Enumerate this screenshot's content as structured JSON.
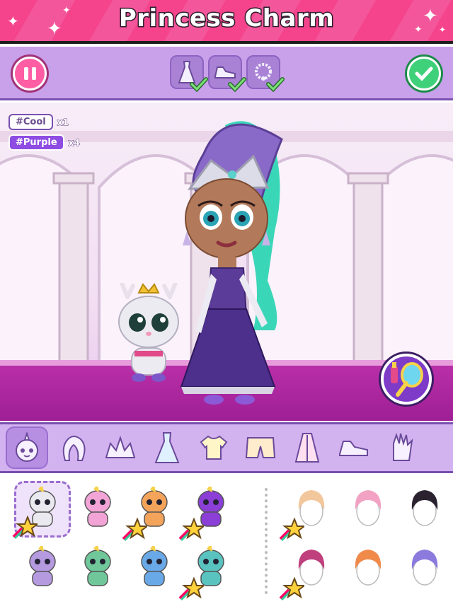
{
  "header": {
    "title": "Princess Charm"
  },
  "toolbar": {
    "pause_icon": "pause-icon",
    "done_icon": "check-icon",
    "progress_slots": [
      {
        "icon": "dress-icon",
        "complete": true
      },
      {
        "icon": "sneaker-icon",
        "complete": true
      },
      {
        "icon": "necklace-icon",
        "complete": true
      }
    ]
  },
  "scene": {
    "tags": [
      {
        "label": "#Cool",
        "count": "x1"
      },
      {
        "label": "#Purple",
        "count": "x4"
      }
    ],
    "mirror_icon": "makeup-mirror-icon"
  },
  "categories": [
    {
      "icon": "unicorn-pet-icon",
      "active": true
    },
    {
      "icon": "hair-icon",
      "active": false
    },
    {
      "icon": "tiara-icon",
      "active": false
    },
    {
      "icon": "dress-icon",
      "active": false
    },
    {
      "icon": "top-icon",
      "active": false
    },
    {
      "icon": "shorts-icon",
      "active": false
    },
    {
      "icon": "cape-icon",
      "active": false
    },
    {
      "icon": "sneaker-icon",
      "active": false
    },
    {
      "icon": "glove-icon",
      "active": false
    }
  ],
  "items": {
    "pets": [
      {
        "name": "deer-pet",
        "color": "#e9e9ef",
        "premium": true,
        "selected": true
      },
      {
        "name": "pink-pony",
        "color": "#f3a4d6",
        "premium": false
      },
      {
        "name": "orange-pony",
        "color": "#f4a45a",
        "premium": true
      },
      {
        "name": "purple-dragon",
        "color": "#8b3fd6",
        "premium": true
      },
      {
        "name": "lavender-pony",
        "color": "#b59ae0",
        "premium": false
      },
      {
        "name": "green-pony",
        "color": "#6fc79a",
        "premium": false
      },
      {
        "name": "blue-pony",
        "color": "#6aa9e8",
        "premium": false
      },
      {
        "name": "teal-dragon",
        "color": "#59c3c0",
        "premium": true
      }
    ],
    "hairstyles": [
      {
        "name": "blonde-ponytail",
        "color": "#f2c79b",
        "premium": true
      },
      {
        "name": "pink-bob",
        "color": "#f2a3c4",
        "premium": false
      },
      {
        "name": "black-bun",
        "color": "#2b2230",
        "premium": false
      },
      {
        "name": "pink-long",
        "color": "#c0407e",
        "premium": true
      },
      {
        "name": "orange-pigtails",
        "color": "#f08a4b",
        "premium": false
      },
      {
        "name": "purple-bun",
        "color": "#8c7bdc",
        "premium": false
      }
    ]
  },
  "colors": {
    "banner": "#f5448c",
    "toolbar": "#c9a0ea",
    "floor": "#b92fa8",
    "accent_green": "#3fd07a",
    "accent_pink": "#ff5ea4"
  }
}
